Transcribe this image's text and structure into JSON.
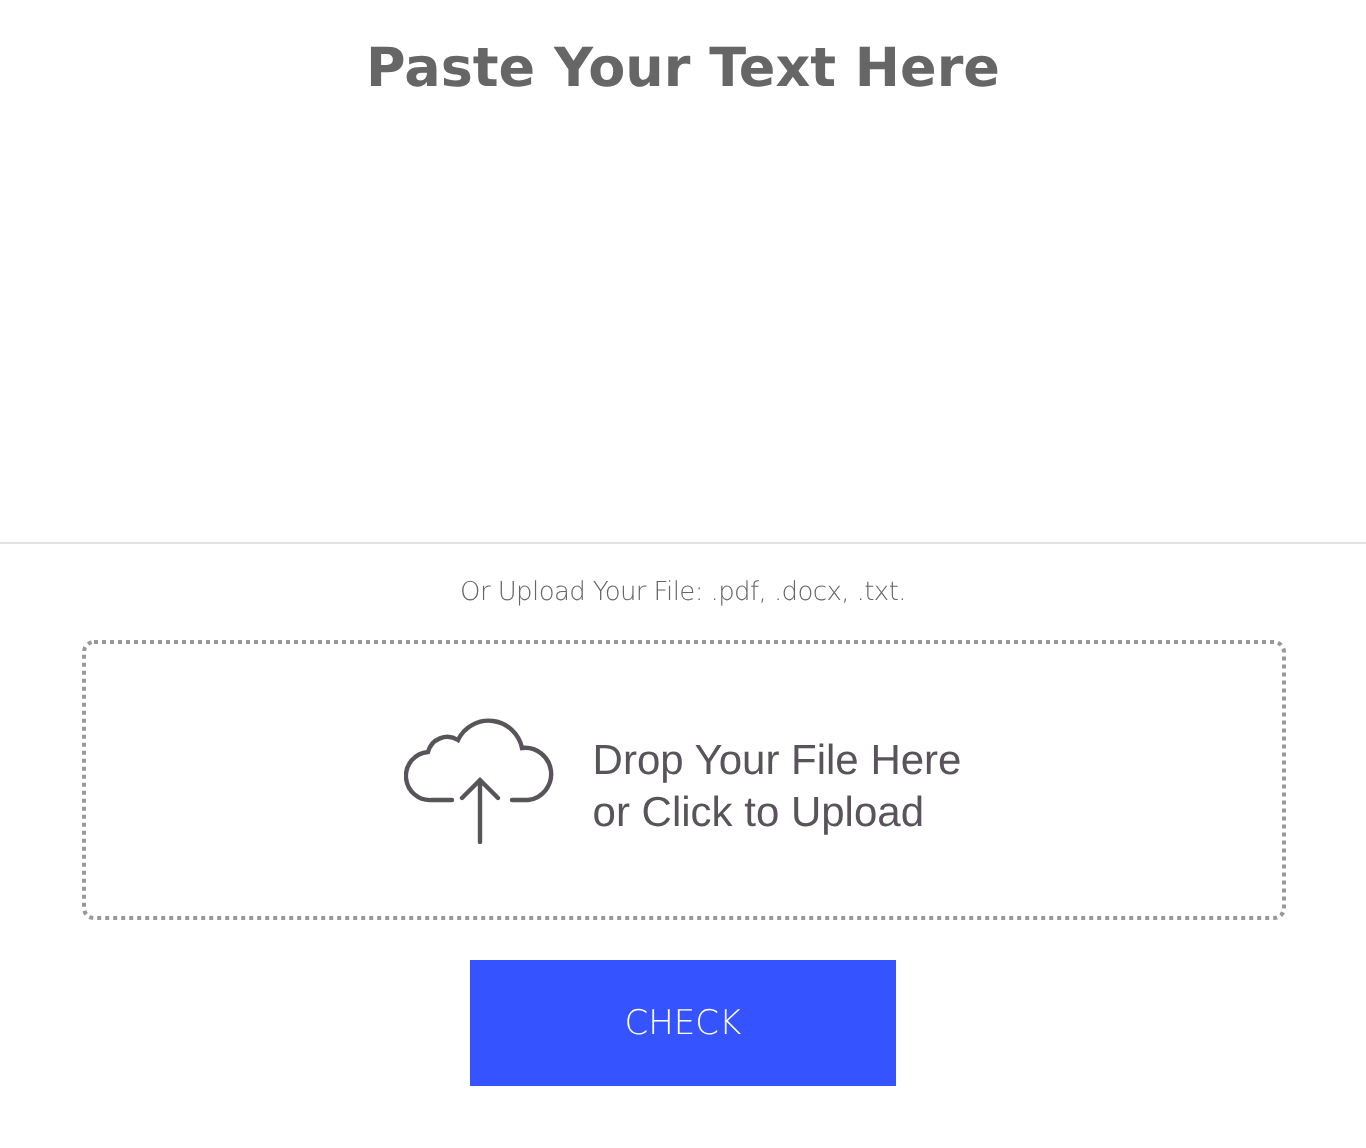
{
  "title": "Paste Your Text Here",
  "upload_hint": "Or Upload Your File: .pdf, .docx, .txt.",
  "dropzone": {
    "lines": [
      "Drop Your File Here",
      "or Click to Upload"
    ]
  },
  "button": {
    "label": "CHECK"
  }
}
